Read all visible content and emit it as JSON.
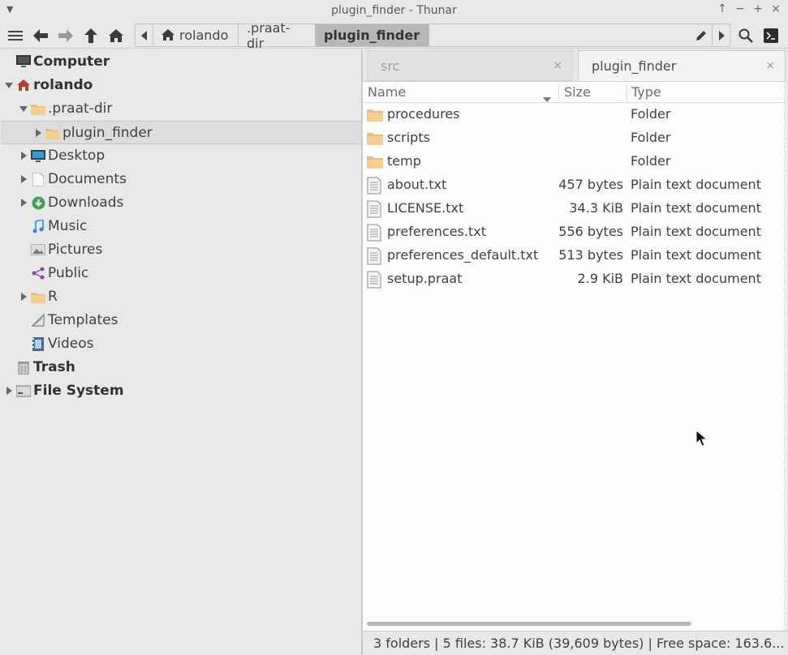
{
  "window": {
    "title": "plugin_finder - Thunar"
  },
  "toolbar": {
    "path": [
      {
        "label": "rolando",
        "icon": "home-icon"
      },
      {
        "label": ".praat-dir"
      },
      {
        "label": "plugin_finder",
        "active": true
      }
    ]
  },
  "sidebar": {
    "items": [
      {
        "label": "Computer",
        "icon": "computer-icon",
        "bold": true,
        "level": 0,
        "expander": "none"
      },
      {
        "label": "rolando",
        "icon": "home-icon",
        "bold": true,
        "level": 0,
        "expander": "open"
      },
      {
        "label": ".praat-dir",
        "icon": "folder-icon",
        "level": 1,
        "expander": "open"
      },
      {
        "label": "plugin_finder",
        "icon": "folder-icon",
        "level": 2,
        "expander": "closed",
        "selected": true
      },
      {
        "label": "Desktop",
        "icon": "desktop-icon",
        "level": 1,
        "expander": "closed"
      },
      {
        "label": "Documents",
        "icon": "document-icon",
        "level": 1,
        "expander": "closed"
      },
      {
        "label": "Downloads",
        "icon": "download-icon",
        "level": 1,
        "expander": "closed"
      },
      {
        "label": "Music",
        "icon": "music-icon",
        "level": 1,
        "expander": "none"
      },
      {
        "label": "Pictures",
        "icon": "pictures-icon",
        "level": 1,
        "expander": "none"
      },
      {
        "label": "Public",
        "icon": "share-icon",
        "level": 1,
        "expander": "none"
      },
      {
        "label": "R",
        "icon": "folder-icon",
        "level": 1,
        "expander": "closed"
      },
      {
        "label": "Templates",
        "icon": "template-icon",
        "level": 1,
        "expander": "none"
      },
      {
        "label": "Videos",
        "icon": "video-icon",
        "level": 1,
        "expander": "none"
      },
      {
        "label": "Trash",
        "icon": "trash-icon",
        "bold": true,
        "level": 0,
        "expander": "none"
      },
      {
        "label": "File System",
        "icon": "drive-icon",
        "bold": true,
        "level": 0,
        "expander": "closed"
      }
    ]
  },
  "tabs": [
    {
      "label": "src",
      "active": false
    },
    {
      "label": "plugin_finder",
      "active": true
    }
  ],
  "columns": {
    "name": "Name",
    "size": "Size",
    "type": "Type"
  },
  "files": [
    {
      "name": "procedures",
      "size": "",
      "type": "Folder",
      "icon": "folder-icon"
    },
    {
      "name": "scripts",
      "size": "",
      "type": "Folder",
      "icon": "folder-icon"
    },
    {
      "name": "temp",
      "size": "",
      "type": "Folder",
      "icon": "folder-icon"
    },
    {
      "name": "about.txt",
      "size": "457 bytes",
      "type": "Plain text document",
      "icon": "text-file-icon"
    },
    {
      "name": "LICENSE.txt",
      "size": "34.3 KiB",
      "type": "Plain text document",
      "icon": "text-file-icon"
    },
    {
      "name": "preferences.txt",
      "size": "556 bytes",
      "type": "Plain text document",
      "icon": "text-file-icon"
    },
    {
      "name": "preferences_default.txt",
      "size": "513 bytes",
      "type": "Plain text document",
      "icon": "text-file-icon"
    },
    {
      "name": "setup.praat",
      "size": "2.9 KiB",
      "type": "Plain text document",
      "icon": "text-file-icon"
    }
  ],
  "status": {
    "text": "3 folders  |  5 files: 38.7 KiB (39,609 bytes)  |  Free space: 163.6..."
  },
  "colors": {
    "window_bg": "#e8e8e7",
    "content_bg": "#fcfcfc",
    "folder": "#f3cf93",
    "active_crumb": "#b6b8ba"
  }
}
